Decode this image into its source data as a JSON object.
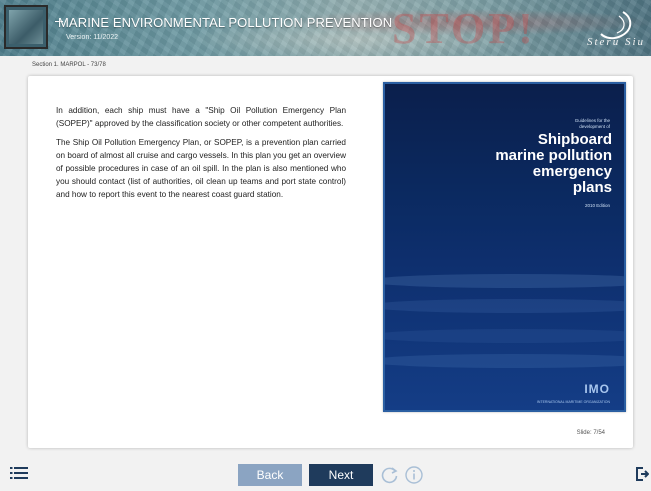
{
  "header": {
    "title": "MARINE ENVIRONMENTAL POLLUTION PREVENTION",
    "version": "Version: 11/2022",
    "stop_text": "STOP!",
    "brand": "Steru Siu"
  },
  "breadcrumb": "Section 1. MARPOL - 73/78",
  "content": {
    "paragraphs": [
      "In addition, each ship must have a \"Ship Oil Pollution Emergency Plan (SOPEP)\" approved by the classification society or other competent authorities.",
      "The Ship Oil Pollution Emergency Plan, or SOPEP, is a prevention plan carried on board of almost all cruise and cargo vessels. In this plan you get an overview of possible procedures in case of an oil spill. In the plan is also mentioned who you should contact (list of authorities, oil clean up teams and port state control) and how to report this event to the nearest coast guard station."
    ]
  },
  "book": {
    "small_text": "Guidelines for the development of",
    "title_lines": [
      "Shipboard",
      "marine pollution",
      "emergency",
      "plans"
    ],
    "edition": "2010 Edition",
    "logo": "IMO",
    "logo_sub": "INTERNATIONAL MARITIME ORGANIZATION"
  },
  "slide": "Slide: 7/54",
  "nav": {
    "back_label": "Back",
    "next_label": "Next"
  },
  "icons": {
    "menu": "menu-icon",
    "reload": "reload-icon",
    "info": "info-icon",
    "exit": "exit-icon"
  },
  "colors": {
    "next_button": "#1f3b5c",
    "back_button": "#8ba4c2",
    "book_cover": "#0b2a61"
  }
}
